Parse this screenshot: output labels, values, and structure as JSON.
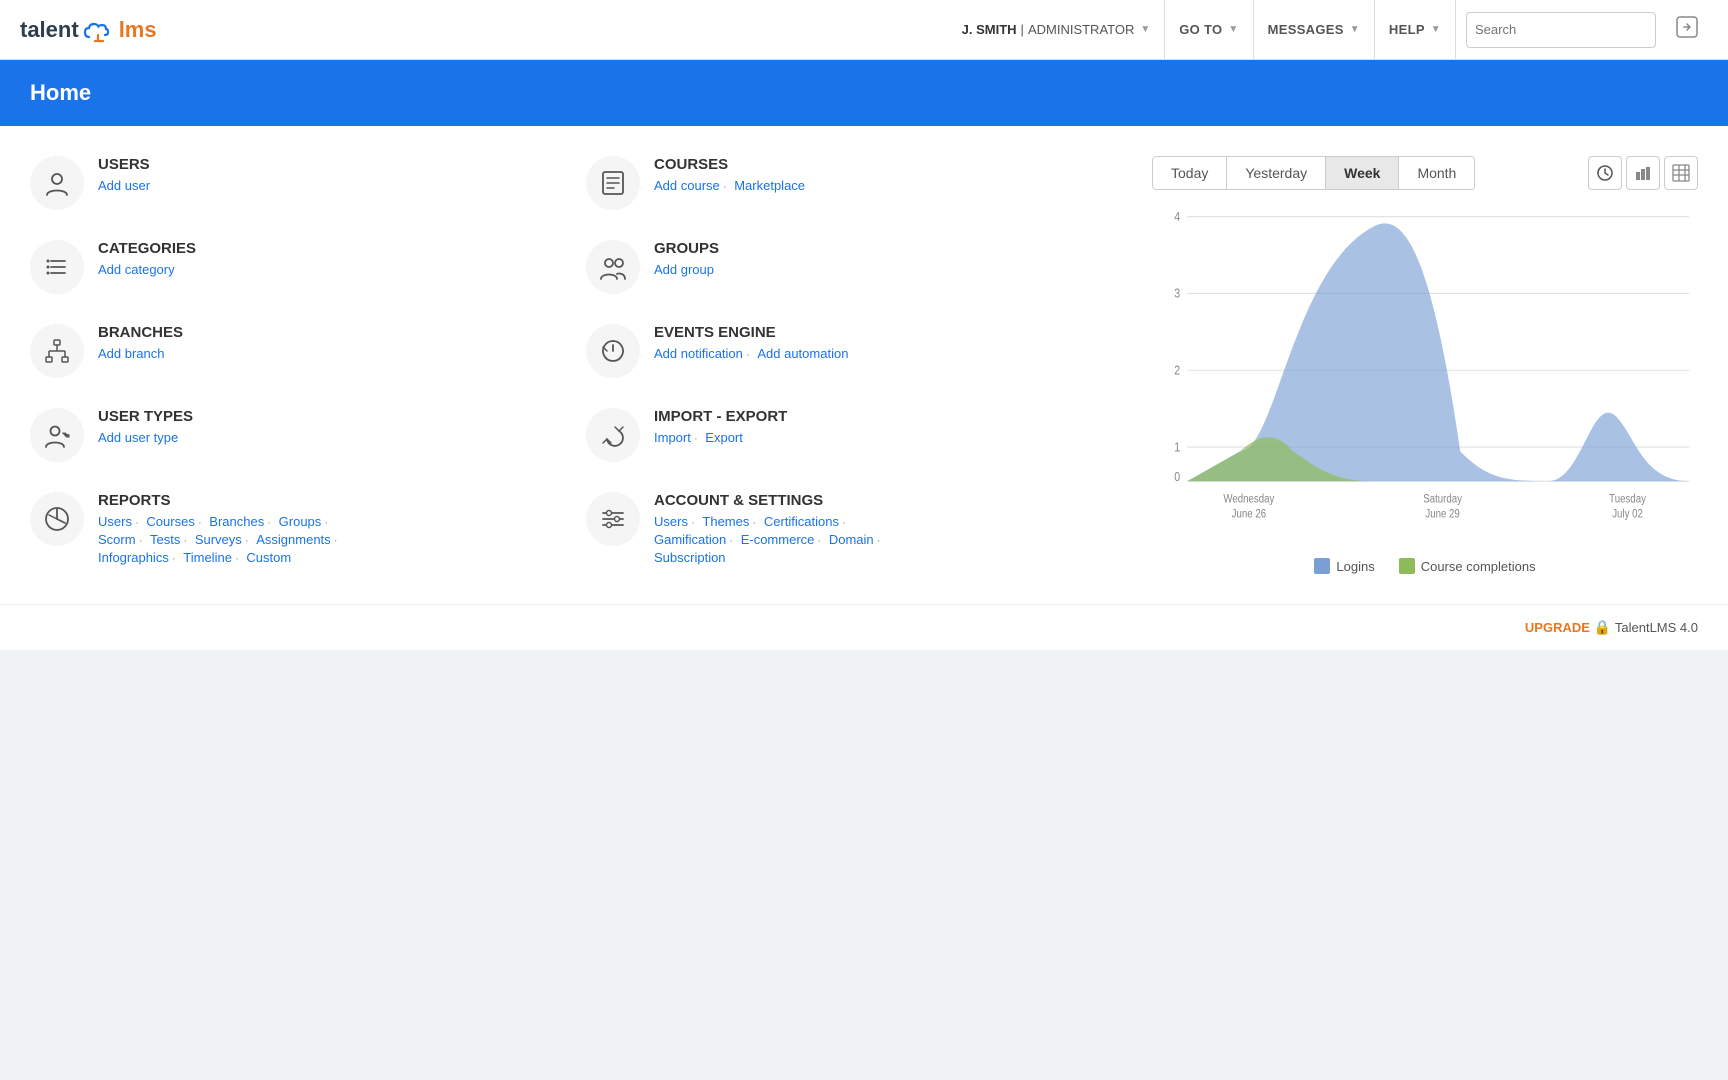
{
  "topnav": {
    "logo": {
      "talent": "talent",
      "lms": "lms"
    },
    "user": {
      "name": "J. SMITH",
      "role": "ADMINISTRATOR"
    },
    "goto_label": "GO TO",
    "messages_label": "MESSAGES",
    "help_label": "HELP",
    "search_placeholder": "Search",
    "logout_label": "→"
  },
  "home": {
    "title": "Home"
  },
  "sections": {
    "users": {
      "title": "USERS",
      "links": [
        {
          "label": "Add user",
          "href": "#"
        }
      ]
    },
    "courses": {
      "title": "COURSES",
      "links": [
        {
          "label": "Add course",
          "href": "#"
        },
        {
          "label": "Marketplace",
          "href": "#"
        }
      ]
    },
    "categories": {
      "title": "CATEGORIES",
      "links": [
        {
          "label": "Add category",
          "href": "#"
        }
      ]
    },
    "groups": {
      "title": "GROUPS",
      "links": [
        {
          "label": "Add group",
          "href": "#"
        }
      ]
    },
    "branches": {
      "title": "BRANCHES",
      "links": [
        {
          "label": "Add branch",
          "href": "#"
        }
      ]
    },
    "events_engine": {
      "title": "EVENTS ENGINE",
      "links": [
        {
          "label": "Add notification",
          "href": "#"
        },
        {
          "label": "Add automation",
          "href": "#"
        }
      ]
    },
    "user_types": {
      "title": "USER TYPES",
      "links": [
        {
          "label": "Add user type",
          "href": "#"
        }
      ]
    },
    "import_export": {
      "title": "IMPORT - EXPORT",
      "links": [
        {
          "label": "Import",
          "href": "#"
        },
        {
          "label": "Export",
          "href": "#"
        }
      ]
    },
    "reports": {
      "title": "REPORTS",
      "links": [
        {
          "label": "Users",
          "href": "#"
        },
        {
          "label": "Courses",
          "href": "#"
        },
        {
          "label": "Branches",
          "href": "#"
        },
        {
          "label": "Groups",
          "href": "#"
        },
        {
          "label": "Scorm",
          "href": "#"
        },
        {
          "label": "Tests",
          "href": "#"
        },
        {
          "label": "Surveys",
          "href": "#"
        },
        {
          "label": "Assignments",
          "href": "#"
        },
        {
          "label": "Infographics",
          "href": "#"
        },
        {
          "label": "Timeline",
          "href": "#"
        },
        {
          "label": "Custom",
          "href": "#"
        }
      ]
    },
    "account_settings": {
      "title": "ACCOUNT & SETTINGS",
      "links": [
        {
          "label": "Users",
          "href": "#"
        },
        {
          "label": "Themes",
          "href": "#"
        },
        {
          "label": "Certifications",
          "href": "#"
        },
        {
          "label": "Gamification",
          "href": "#"
        },
        {
          "label": "E-commerce",
          "href": "#"
        },
        {
          "label": "Domain",
          "href": "#"
        },
        {
          "label": "Subscription",
          "href": "#"
        }
      ]
    }
  },
  "chart": {
    "tabs": [
      "Today",
      "Yesterday",
      "Week",
      "Month"
    ],
    "active_tab": "Week",
    "y_labels": [
      "0",
      "1",
      "2",
      "3",
      "4"
    ],
    "x_labels": [
      {
        "line1": "Wednesday",
        "line2": "June 26"
      },
      {
        "line1": "Saturday",
        "line2": "June 29"
      },
      {
        "line1": "Tuesday",
        "line2": "July 02"
      }
    ],
    "legend": {
      "logins": "Logins",
      "completions": "Course completions"
    }
  },
  "footer": {
    "upgrade_label": "UPGRADE",
    "version": "TalentLMS 4.0"
  }
}
